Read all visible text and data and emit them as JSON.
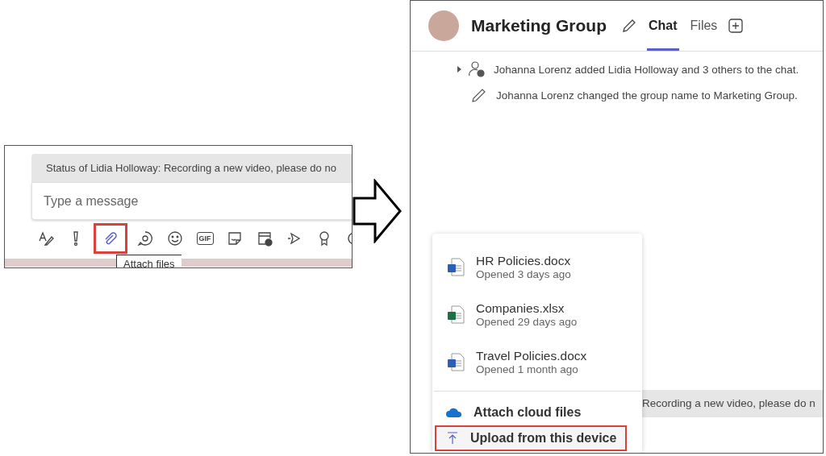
{
  "compose_panel": {
    "status_banner": "Status of Lidia Holloway: Recording a new video, please do no",
    "message_field": {
      "placeholder": "Type a message"
    },
    "toolbar": [
      {
        "kind": "format",
        "highlighted": false
      },
      {
        "kind": "important",
        "highlighted": false
      },
      {
        "kind": "attach",
        "highlighted": true
      },
      {
        "kind": "loop",
        "highlighted": false
      },
      {
        "kind": "emoji",
        "highlighted": false
      },
      {
        "kind": "gif",
        "label": "GIF",
        "highlighted": false
      },
      {
        "kind": "sticker",
        "highlighted": false
      },
      {
        "kind": "meeting",
        "highlighted": false
      },
      {
        "kind": "stream",
        "highlighted": false
      },
      {
        "kind": "praise",
        "highlighted": false
      },
      {
        "kind": "loop-arrow",
        "highlighted": false
      }
    ],
    "tooltip": "Attach files"
  },
  "chat_panel": {
    "title": "Marketing Group",
    "tabs": [
      {
        "label": "Chat",
        "selected": true
      },
      {
        "label": "Files",
        "selected": false
      }
    ],
    "messages": [
      {
        "kind": "added",
        "text": "Johanna Lorenz added Lidia Holloway and 3 others to the chat."
      },
      {
        "kind": "renamed",
        "text": "Johanna Lorenz changed the group name to Marketing Group."
      }
    ],
    "status_banner": "Recording a new video, please do n",
    "attach_menu": {
      "recent_files": [
        {
          "kind": "word",
          "name": "HR Policies.docx",
          "opened": "Opened 3 days ago"
        },
        {
          "kind": "excel",
          "name": "Companies.xlsx",
          "opened": "Opened 29 days ago"
        },
        {
          "kind": "word",
          "name": "Travel Policies.docx",
          "opened": "Opened 1 month ago"
        }
      ],
      "actions": [
        {
          "kind": "cloud",
          "label": "Attach cloud files",
          "highlighted": false
        },
        {
          "kind": "upload",
          "label": "Upload from this device",
          "highlighted": true
        }
      ]
    }
  }
}
